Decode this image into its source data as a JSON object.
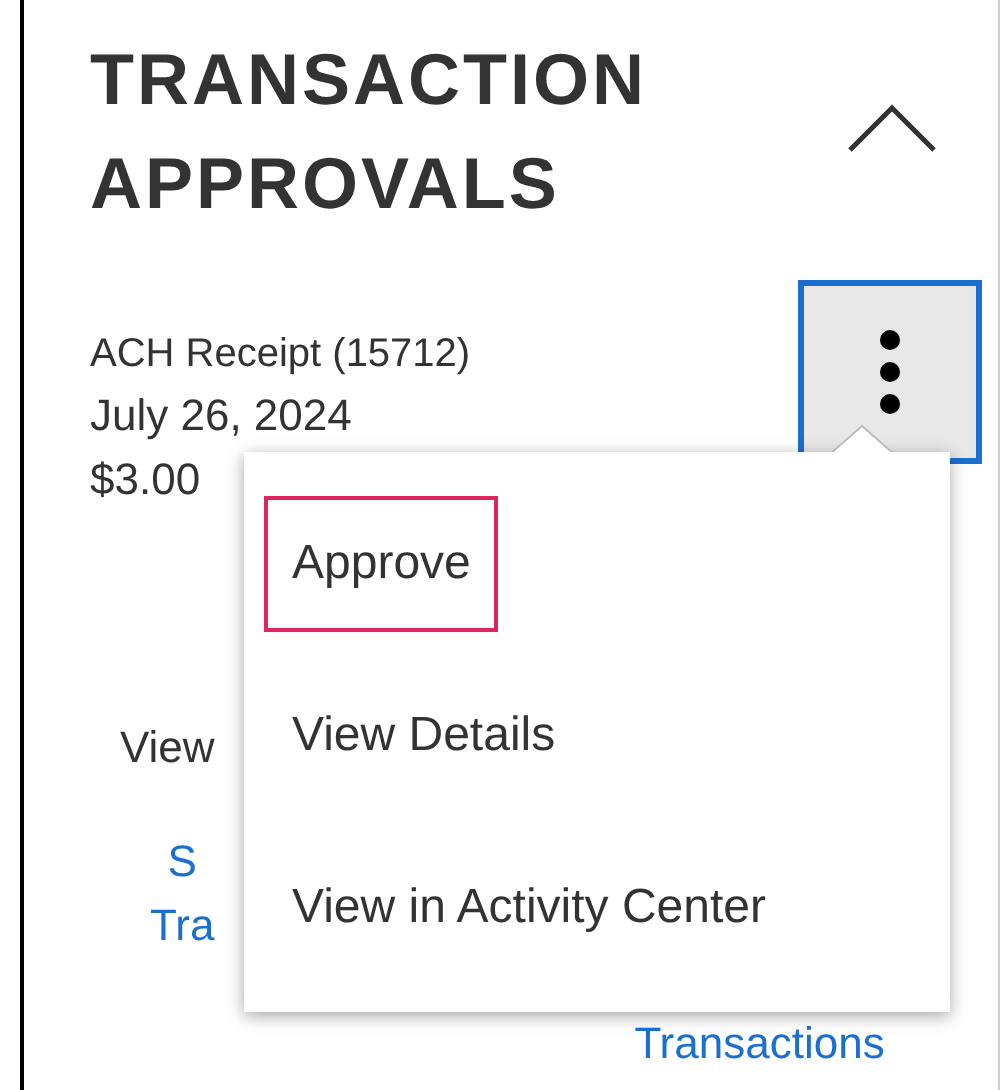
{
  "panel": {
    "title": "TRANSACTION APPROVALS",
    "expanded": true
  },
  "transaction": {
    "name": "ACH Receipt (15712)",
    "date": "July 26, 2024",
    "amount": "$3.00"
  },
  "menu": {
    "open": true,
    "items": [
      {
        "label": "Approve",
        "selected": true
      },
      {
        "label": "View Details",
        "selected": false
      },
      {
        "label": "View in Activity Center",
        "selected": false
      }
    ]
  },
  "footer": {
    "text": "View",
    "links": [
      {
        "lines": [
          "S",
          "Tra"
        ]
      },
      {
        "lines": [
          "Transactions"
        ]
      }
    ]
  }
}
